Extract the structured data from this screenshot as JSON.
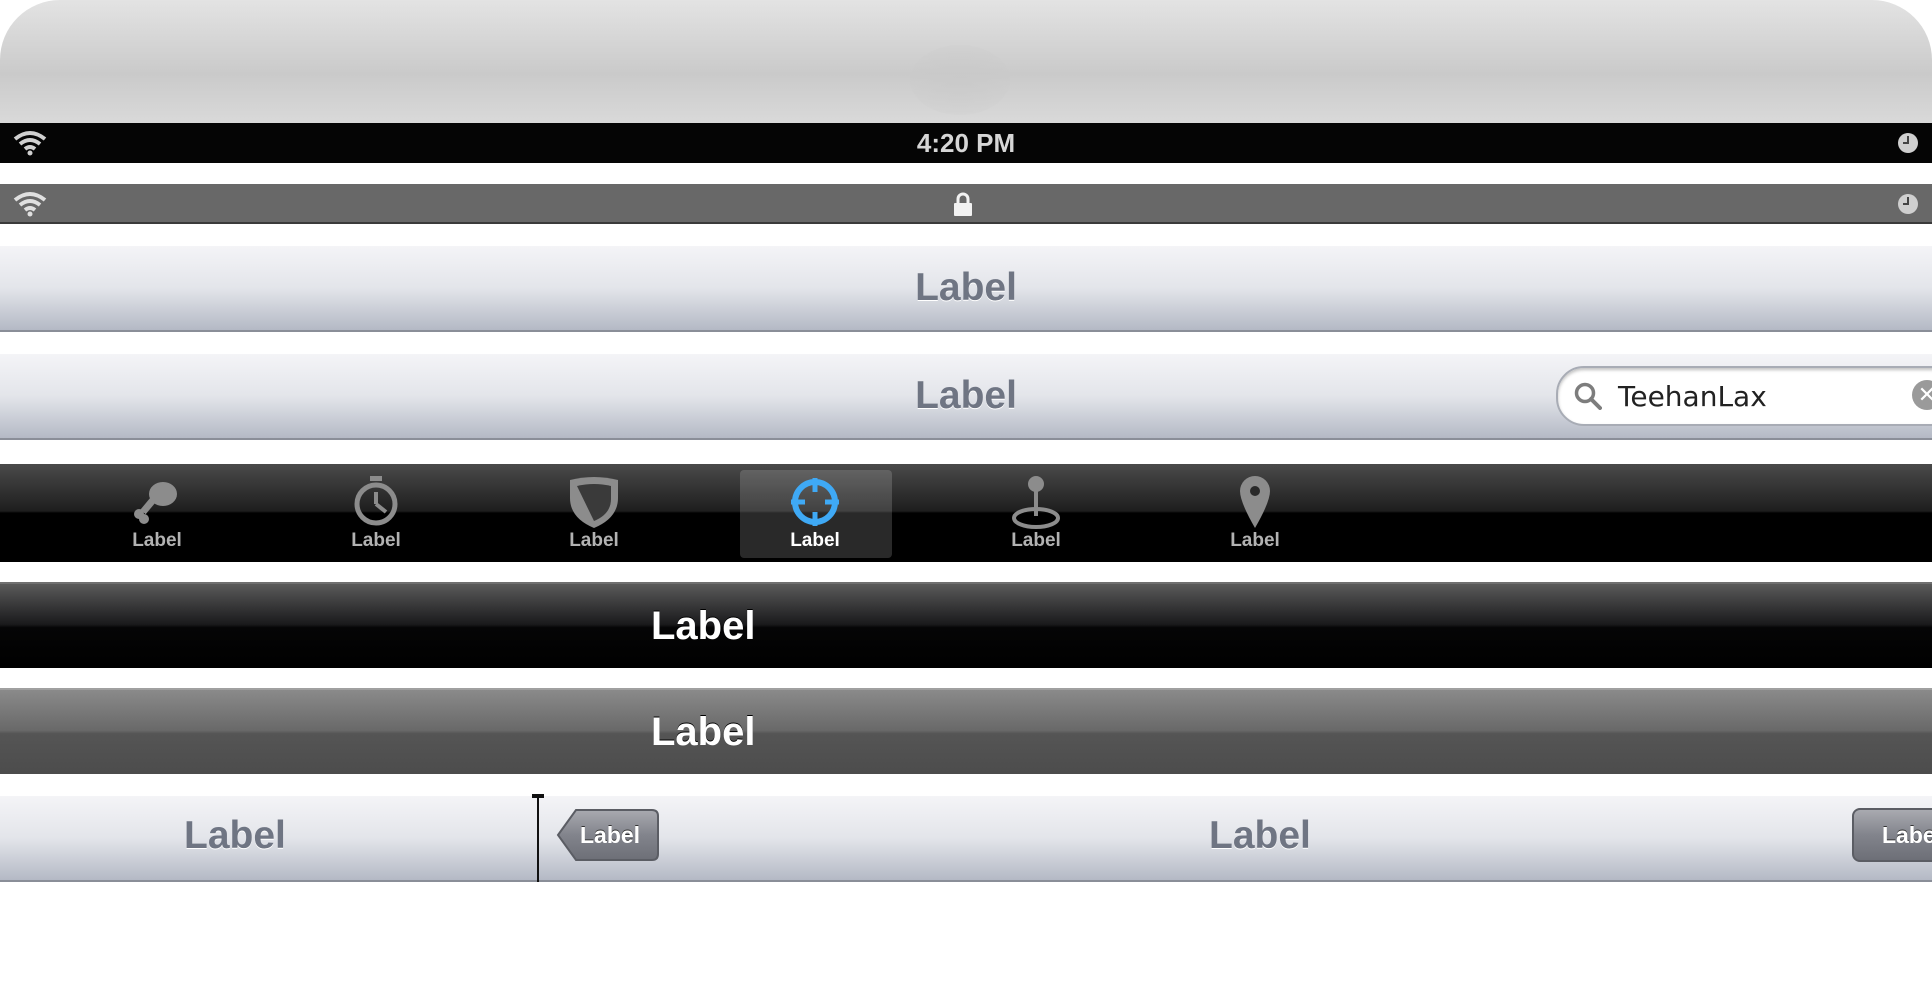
{
  "status_bar_dark": {
    "time": "4:20 PM",
    "left_icon": "wifi-icon",
    "right_icon": "clock-icon"
  },
  "status_bar_gray": {
    "left_icon": "wifi-icon",
    "center_icon": "lock-icon",
    "right_icon": "clock-icon"
  },
  "nav_bar_1": {
    "title": "Label"
  },
  "nav_bar_2": {
    "title": "Label",
    "search": {
      "value": "TeehanLax",
      "search_icon": "search-icon",
      "clear_icon": "clear-icon"
    }
  },
  "tab_bar": {
    "tabs": [
      {
        "label": "Label",
        "icon": "drumstick-icon",
        "active": false
      },
      {
        "label": "Label",
        "icon": "stopwatch-icon",
        "active": false
      },
      {
        "label": "Label",
        "icon": "shield-icon",
        "active": false
      },
      {
        "label": "Label",
        "icon": "crosshair-icon",
        "active": true
      },
      {
        "label": "Label",
        "icon": "joystick-icon",
        "active": false
      },
      {
        "label": "Label",
        "icon": "map-pin-icon",
        "active": false
      }
    ]
  },
  "dark_bar_black": {
    "title": "Label"
  },
  "dark_bar_gray": {
    "title": "Label"
  },
  "split_bar": {
    "left_title": "Label",
    "back_button": "Label",
    "right_title": "Label",
    "right_button": "Label"
  },
  "colors": {
    "accent_active": "#3fa9f5",
    "nav_text": "#6f7583",
    "bar_dark": "#000000"
  }
}
